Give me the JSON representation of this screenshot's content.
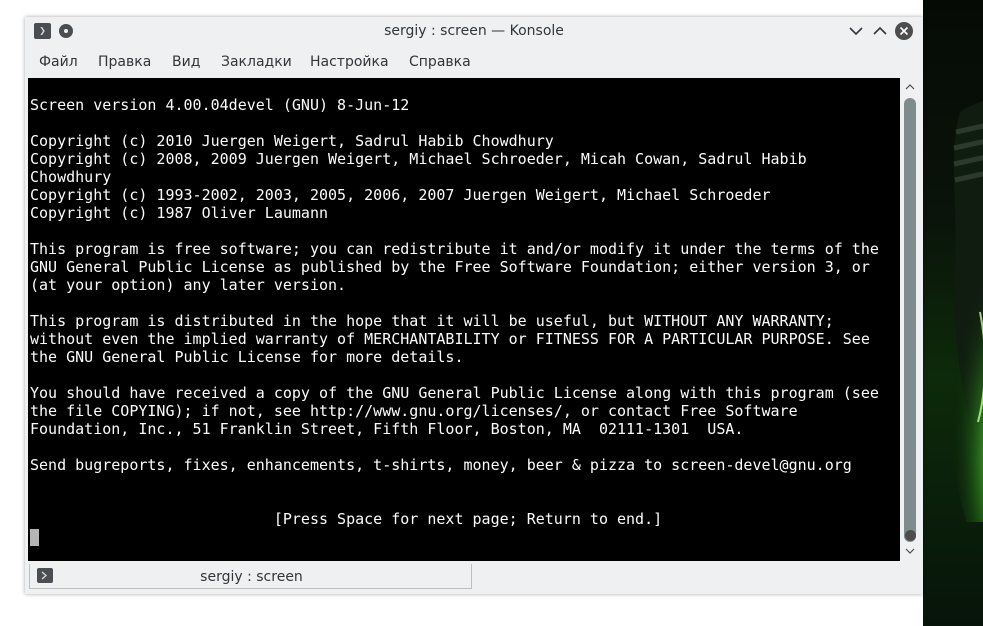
{
  "window": {
    "title": "sergiy : screen — Konsole"
  },
  "menubar": {
    "items": [
      "Файл",
      "Правка",
      "Вид",
      "Закладки",
      "Настройка",
      "Справка"
    ]
  },
  "terminal": {
    "lines": [
      "Screen version 4.00.04devel (GNU) 8-Jun-12",
      "",
      "Copyright (c) 2010 Juergen Weigert, Sadrul Habib Chowdhury",
      "Copyright (c) 2008, 2009 Juergen Weigert, Michael Schroeder, Micah Cowan, Sadrul Habib",
      "Chowdhury",
      "Copyright (c) 1993-2002, 2003, 2005, 2006, 2007 Juergen Weigert, Michael Schroeder",
      "Copyright (c) 1987 Oliver Laumann",
      "",
      "This program is free software; you can redistribute it and/or modify it under the terms of the",
      "GNU General Public License as published by the Free Software Foundation; either version 3, or",
      "(at your option) any later version.",
      "",
      "This program is distributed in the hope that it will be useful, but WITHOUT ANY WARRANTY;",
      "without even the implied warranty of MERCHANTABILITY or FITNESS FOR A PARTICULAR PURPOSE. See",
      "the GNU General Public License for more details.",
      "",
      "You should have received a copy of the GNU General Public License along with this program (see",
      "the file COPYING); if not, see http://www.gnu.org/licenses/, or contact Free Software",
      "Foundation, Inc., 51 Franklin Street, Fifth Floor, Boston, MA  02111-1301  USA.",
      "",
      "Send bugreports, fixes, enhancements, t-shirts, money, beer & pizza to screen-devel@gnu.org",
      "",
      "",
      "                           [Press Space for next page; Return to end.]"
    ],
    "background": "#000000",
    "foreground": "#fcfcfc"
  },
  "tabs": [
    {
      "label": "sergiy : screen"
    }
  ],
  "icons": {
    "app": "terminal-icon",
    "pin": "pin-icon",
    "minimize": "chevron-down-icon",
    "maximize": "chevron-up-icon",
    "close": "close-icon",
    "tab": "terminal-icon"
  },
  "colors": {
    "chrome": "#eff0f1",
    "text": "#31363b",
    "wallpaper_accent": "#3ca028"
  }
}
